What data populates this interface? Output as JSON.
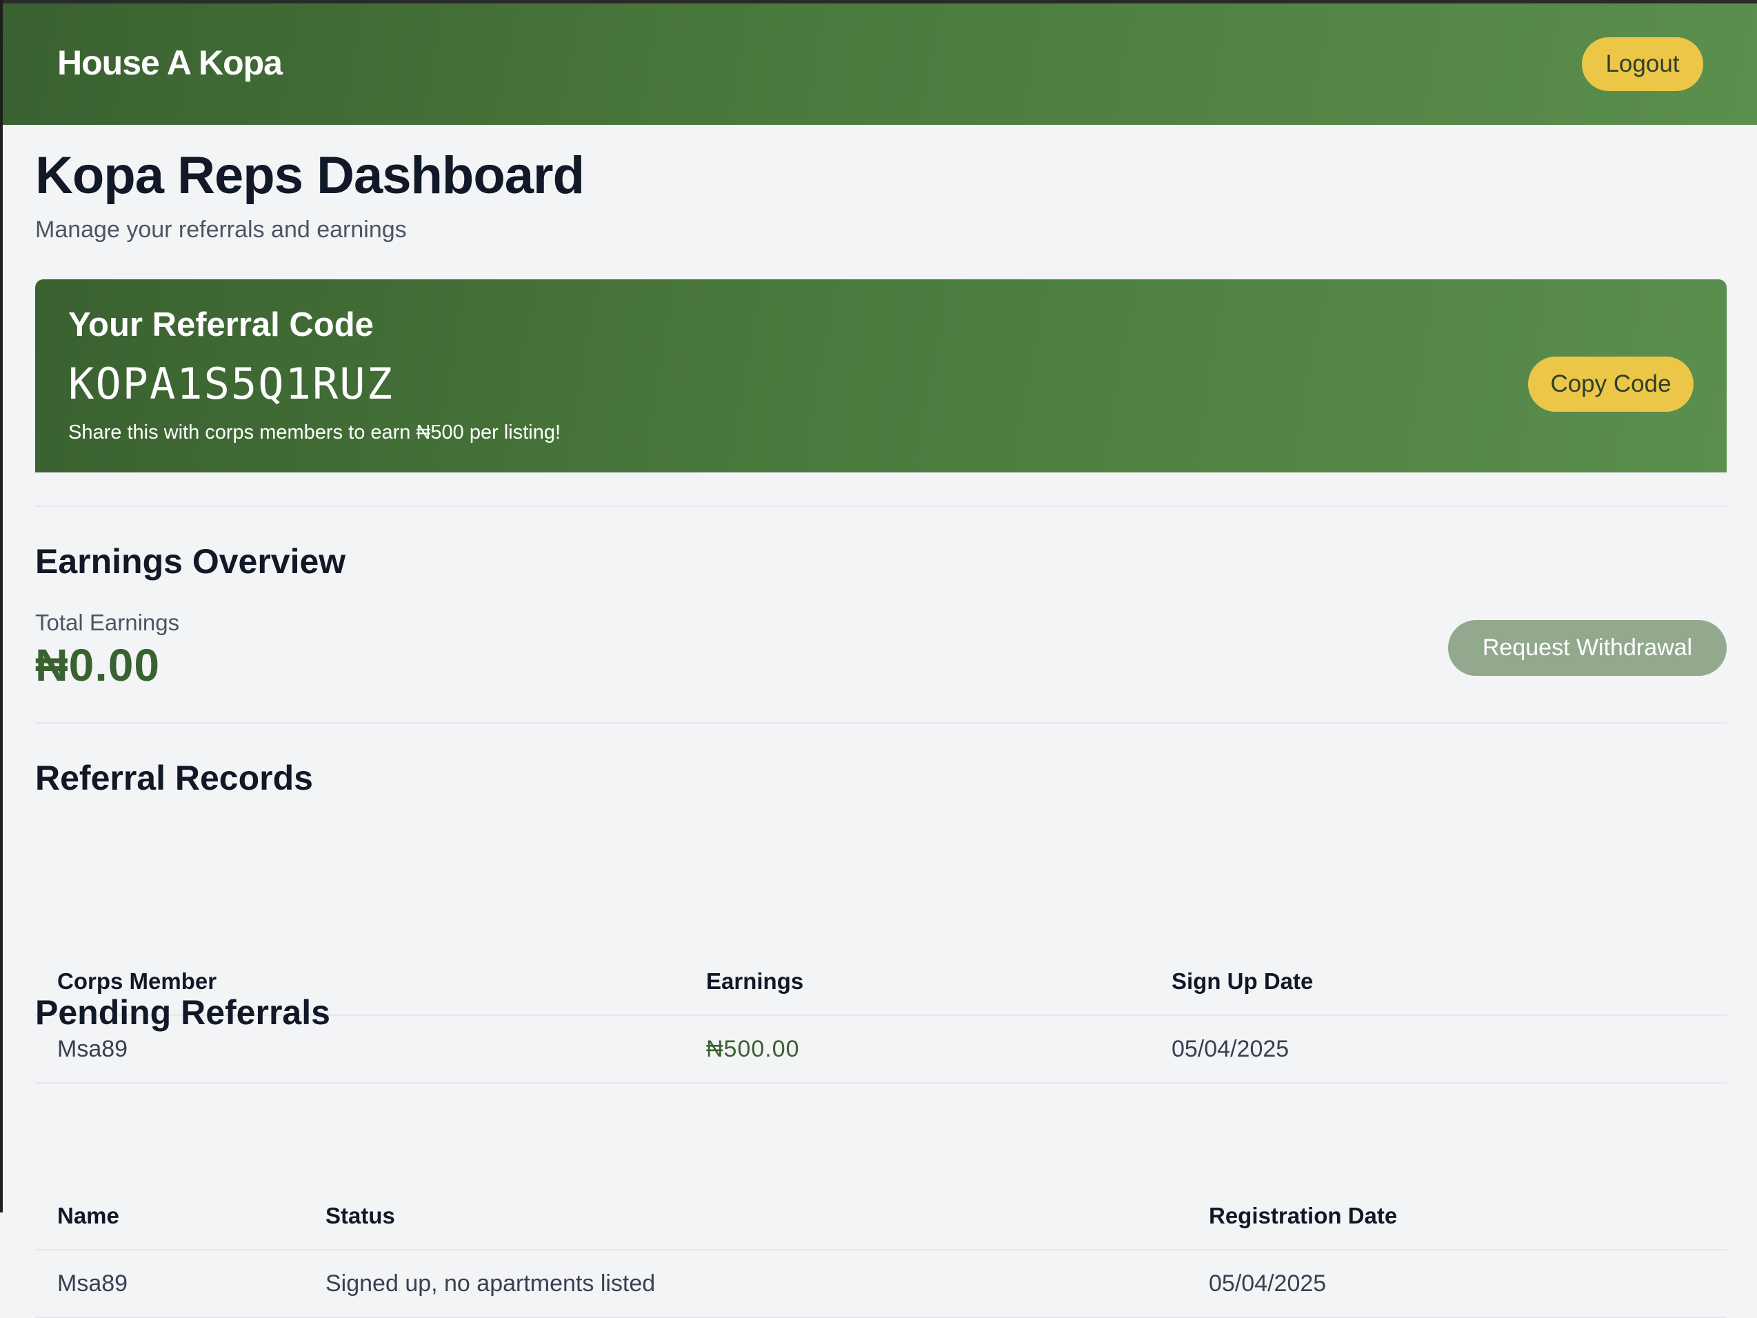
{
  "header": {
    "brand": "House A Kopa",
    "logout_label": "Logout"
  },
  "page": {
    "title": "Kopa Reps Dashboard",
    "subtitle": "Manage your referrals and earnings"
  },
  "referral_card": {
    "title": "Your Referral Code",
    "code": "KOPA1S5Q1RUZ",
    "note": "Share this with corps members to earn ₦500 per listing!",
    "copy_label": "Copy Code"
  },
  "earnings": {
    "title": "Earnings Overview",
    "total_label": "Total Earnings",
    "total_value": "₦0.00",
    "withdraw_label": "Request Withdrawal"
  },
  "referral_records": {
    "title": "Referral Records",
    "columns": [
      "Corps Member",
      "Earnings",
      "Sign Up Date"
    ],
    "rows": [
      [
        "Msa89",
        "₦500.00",
        "05/04/2025"
      ]
    ]
  },
  "pending_referrals": {
    "title": "Pending Referrals",
    "columns": [
      "Name",
      "Status",
      "Registration Date"
    ],
    "rows": [
      [
        "Msa89",
        "Signed up, no apartments listed",
        "05/04/2025"
      ]
    ]
  },
  "colors": {
    "brand_green": "#3a6130",
    "accent_yellow": "#ecc747",
    "disabled_green": "#93a98e",
    "background": "#f3f4f6"
  }
}
